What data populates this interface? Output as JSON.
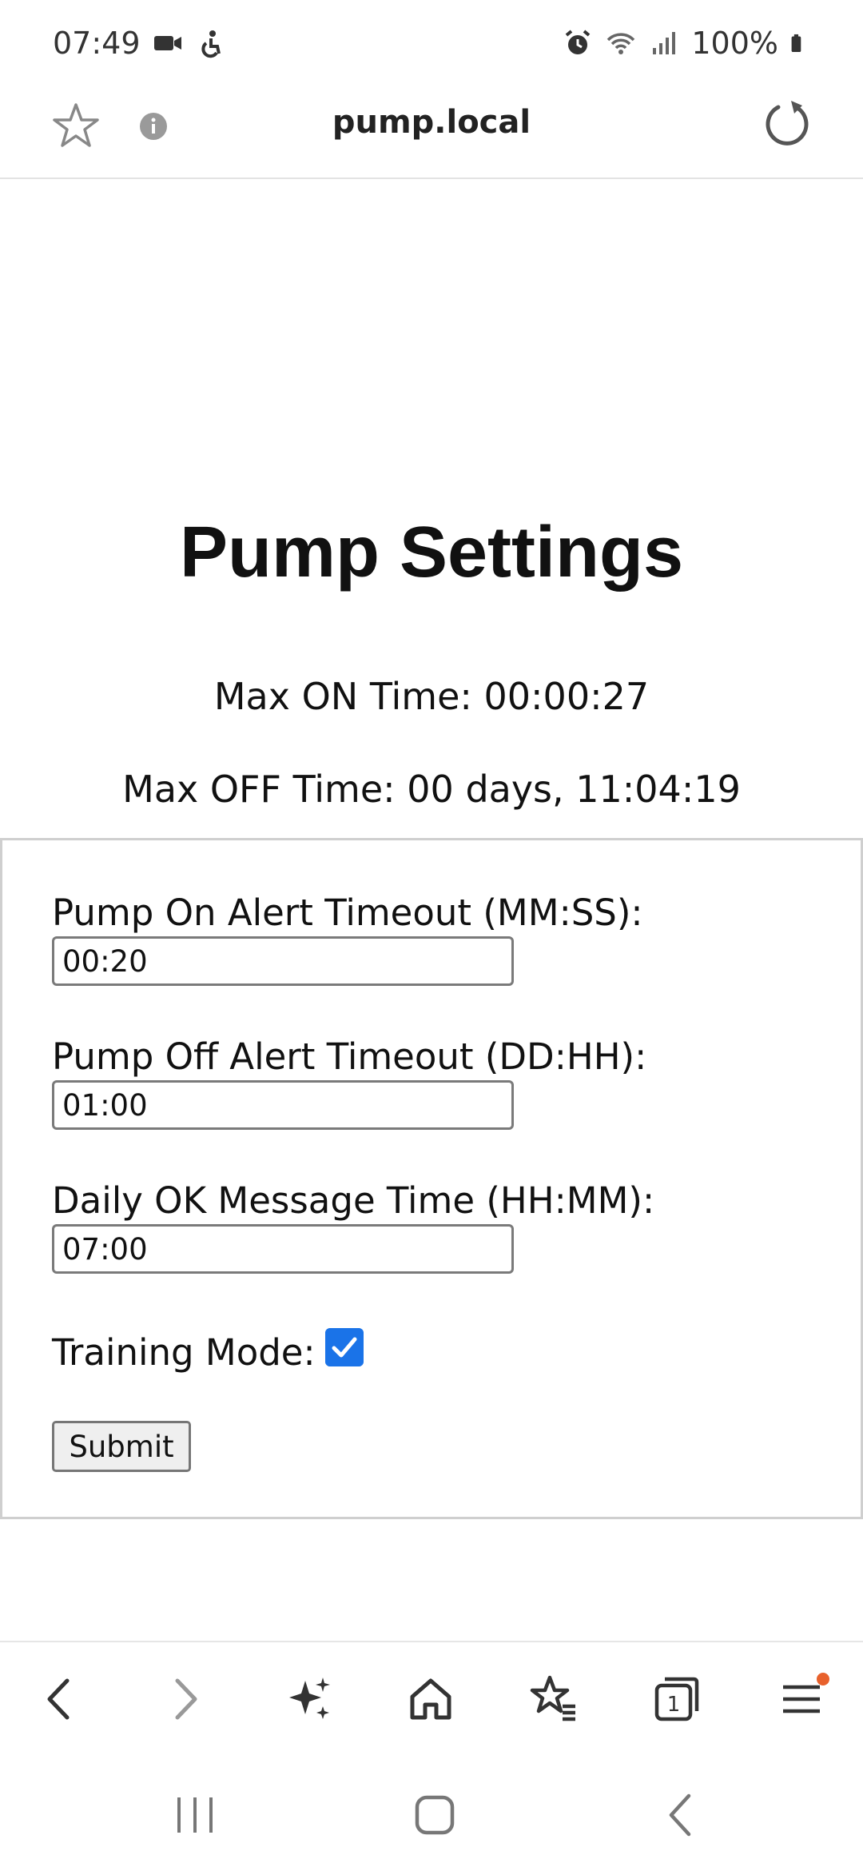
{
  "status_bar": {
    "time": "07:49",
    "battery": "100%",
    "icons_left": [
      "video-call-icon",
      "accessibility-icon"
    ],
    "icons_right": [
      "alarm-icon",
      "wifi-icon",
      "signal-icon",
      "battery-icon"
    ]
  },
  "browser": {
    "url": "pump.local"
  },
  "page": {
    "title": "Pump Settings",
    "max_on": "Max ON Time: 00:00:27",
    "max_off": "Max OFF Time: 00 days, 11:04:19"
  },
  "form": {
    "fields": [
      {
        "label": "Pump On Alert Timeout (MM:SS):",
        "value": "00:20"
      },
      {
        "label": "Pump Off Alert Timeout (DD:HH):",
        "value": "01:00"
      },
      {
        "label": "Daily OK Message Time (HH:MM):",
        "value": "07:00"
      }
    ],
    "training_label": "Training Mode:",
    "training_checked": true,
    "submit_label": "Submit"
  },
  "toolbar": {
    "tab_count": "1",
    "accent_color": "#e8612c"
  },
  "colors": {
    "checkbox": "#1a73e8"
  }
}
